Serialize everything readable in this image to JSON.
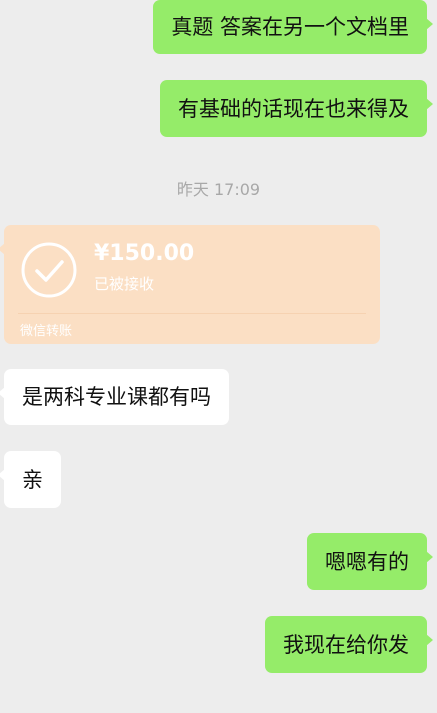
{
  "colors": {
    "background": "#ededed",
    "outgoing_bubble": "#95ec69",
    "incoming_bubble": "#ffffff",
    "transfer_card": "#fbdfc4",
    "timestamp_text": "#a8a8a8"
  },
  "messages": [
    {
      "direction": "out",
      "text": "真题 答案在另一个文档里"
    },
    {
      "direction": "out",
      "text": "有基础的话现在也来得及"
    }
  ],
  "timestamp": "昨天 17:09",
  "transfer": {
    "amount": "¥150.00",
    "status": "已被接收",
    "label": "微信转账",
    "icon": "check-circle-icon"
  },
  "messages_after": [
    {
      "direction": "in",
      "text": "是两科专业课都有吗"
    },
    {
      "direction": "in",
      "text": "亲"
    },
    {
      "direction": "out",
      "text": "嗯嗯有的"
    },
    {
      "direction": "out",
      "text": "我现在给你发"
    }
  ]
}
